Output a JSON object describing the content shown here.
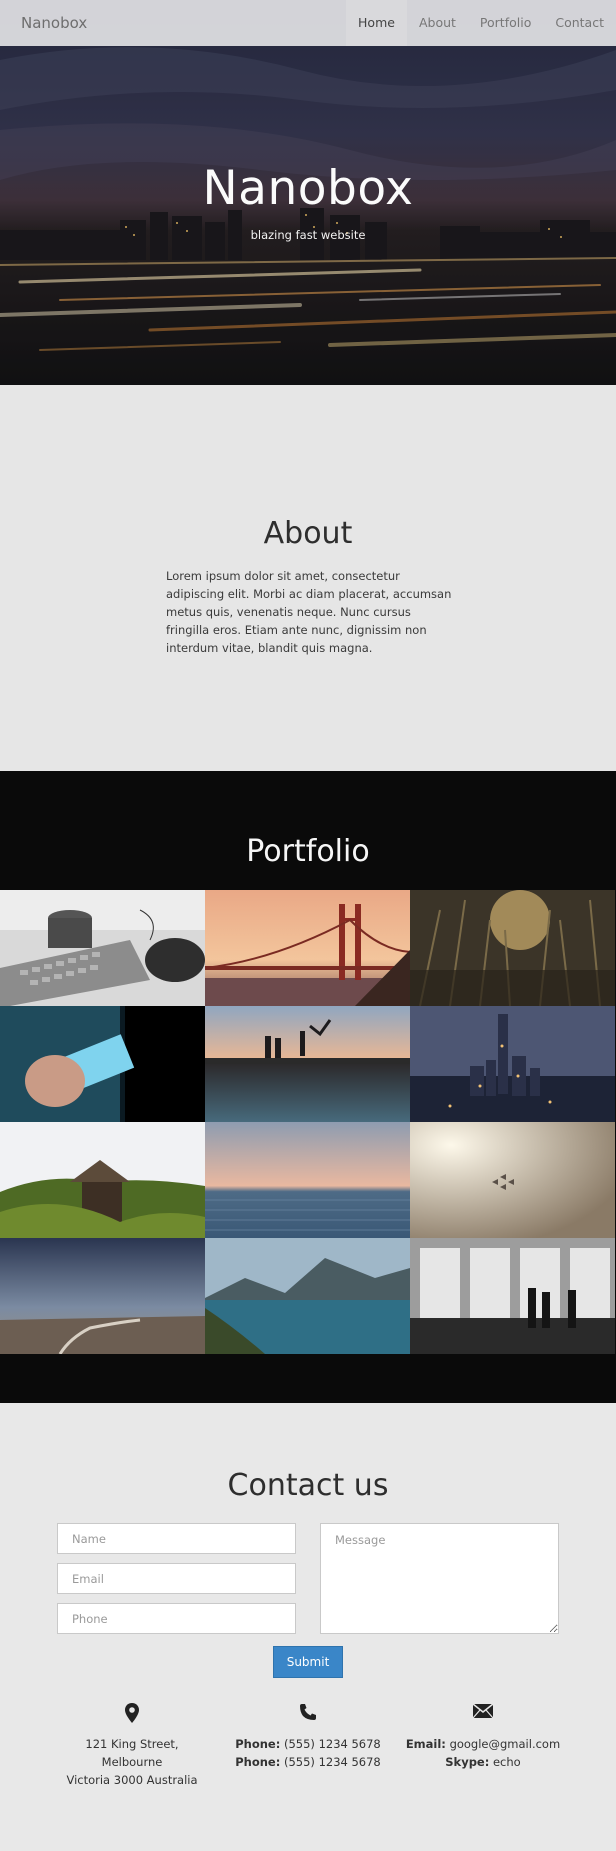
{
  "nav": {
    "brand": "Nanobox",
    "links": [
      {
        "label": "Home",
        "active": true
      },
      {
        "label": "About",
        "active": false
      },
      {
        "label": "Portfolio",
        "active": false
      },
      {
        "label": "Contact",
        "active": false
      }
    ]
  },
  "hero": {
    "title": "Nanobox",
    "subtitle": "blazing fast website"
  },
  "about": {
    "title": "About",
    "text": "Lorem ipsum dolor sit amet, consectetur adipiscing elit. Morbi ac diam placerat, accumsan metus quis, venenatis neque. Nunc cursus fringilla eros. Etiam ante nunc, dignissim non interdum vitae, blandit quis magna."
  },
  "portfolio": {
    "title": "Portfolio",
    "images": [
      {
        "subject": "keyboard and mouse"
      },
      {
        "subject": "golden gate bridge at sunset"
      },
      {
        "subject": "grass at sunset"
      },
      {
        "subject": "hand holding phone"
      },
      {
        "subject": "people at infinity pool"
      },
      {
        "subject": "city skyline at dusk"
      },
      {
        "subject": "cabin in trees"
      },
      {
        "subject": "calm sea horizon"
      },
      {
        "subject": "jets in hazy sky"
      },
      {
        "subject": "road through field"
      },
      {
        "subject": "lake and mountains"
      },
      {
        "subject": "people at observation window"
      }
    ]
  },
  "contact": {
    "title": "Contact us",
    "name_placeholder": "Name",
    "email_placeholder": "Email",
    "phone_placeholder": "Phone",
    "message_placeholder": "Message",
    "submit_label": "Submit",
    "address": {
      "icon": "map-marker-icon",
      "line1": "121 King Street,",
      "line2": "Melbourne",
      "line3": "Victoria 3000 Australia"
    },
    "phones": {
      "icon": "phone-icon",
      "label": "Phone:",
      "number1": "(555) 1234 5678",
      "number2": "(555) 1234 5678"
    },
    "online": {
      "icon": "envelope-icon",
      "email_label": "Email:",
      "email": "google@gmail.com",
      "skype_label": "Skype:",
      "skype": "echo"
    }
  },
  "colors": {
    "accent": "#3a86c8",
    "portfolio_bg": "#0a0a0a",
    "section_bg": "#e8e8e8"
  }
}
